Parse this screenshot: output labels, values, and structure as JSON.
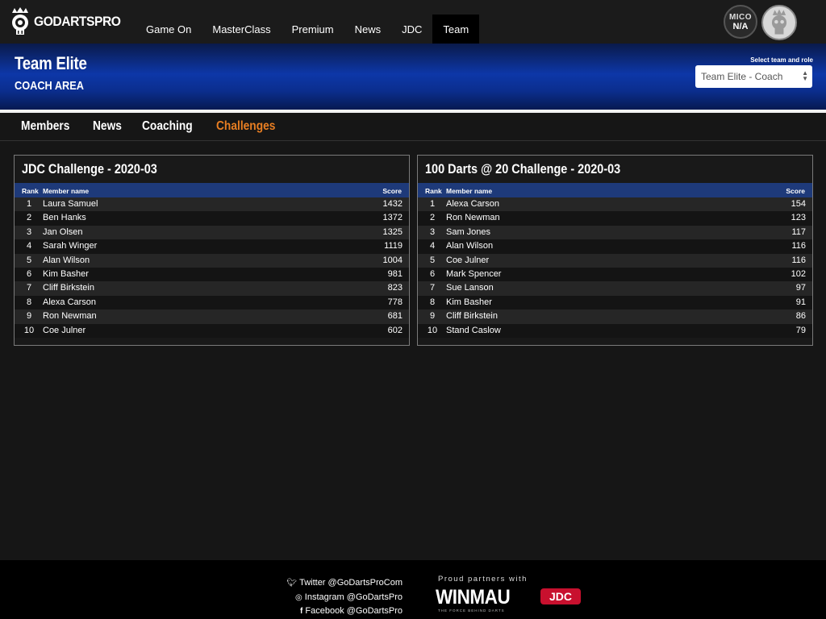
{
  "brand": {
    "name": "GODARTSPRO"
  },
  "nav": {
    "items": [
      {
        "label": "Game On",
        "active": false
      },
      {
        "label": "MasterClass",
        "active": false
      },
      {
        "label": "Premium",
        "active": false
      },
      {
        "label": "News",
        "active": false
      },
      {
        "label": "JDC",
        "active": false
      },
      {
        "label": "Team",
        "active": true
      }
    ]
  },
  "user": {
    "mico_label": "MICO",
    "mico_value": "N/A",
    "avatar_icon": "skull-king-avatar-icon"
  },
  "hero": {
    "title": "Team Elite",
    "subtitle": "COACH AREA",
    "select_label": "Select team and role",
    "select_value": "Team Elite - Coach"
  },
  "subnav": {
    "items": [
      {
        "label": "Members",
        "active": false
      },
      {
        "label": "News",
        "active": false
      },
      {
        "label": "Coaching",
        "active": false
      },
      {
        "label": "Challenges",
        "active": true
      }
    ],
    "active_color": "#e87e22"
  },
  "challenges": [
    {
      "title": "JDC Challenge - 2020-03",
      "headers": {
        "rank": "Rank",
        "name": "Member name",
        "score": "Score"
      },
      "rows": [
        {
          "rank": "1",
          "name": "Laura Samuel",
          "score": "1432"
        },
        {
          "rank": "2",
          "name": "Ben Hanks",
          "score": "1372"
        },
        {
          "rank": "3",
          "name": "Jan Olsen",
          "score": "1325"
        },
        {
          "rank": "4",
          "name": "Sarah Winger",
          "score": "1119"
        },
        {
          "rank": "5",
          "name": "Alan Wilson",
          "score": "1004"
        },
        {
          "rank": "6",
          "name": "Kim Basher",
          "score": "981"
        },
        {
          "rank": "7",
          "name": "Cliff Birkstein",
          "score": "823"
        },
        {
          "rank": "8",
          "name": "Alexa Carson",
          "score": "778"
        },
        {
          "rank": "9",
          "name": "Ron Newman",
          "score": "681"
        },
        {
          "rank": "10",
          "name": "Coe Julner",
          "score": "602"
        }
      ]
    },
    {
      "title": "100 Darts @ 20 Challenge - 2020-03",
      "headers": {
        "rank": "Rank",
        "name": "Member name",
        "score": "Score"
      },
      "rows": [
        {
          "rank": "1",
          "name": "Alexa Carson",
          "score": "154"
        },
        {
          "rank": "2",
          "name": "Ron Newman",
          "score": "123"
        },
        {
          "rank": "3",
          "name": "Sam Jones",
          "score": "117"
        },
        {
          "rank": "4",
          "name": "Alan Wilson",
          "score": "116"
        },
        {
          "rank": "5",
          "name": "Coe Julner",
          "score": "116"
        },
        {
          "rank": "6",
          "name": "Mark Spencer",
          "score": "102"
        },
        {
          "rank": "7",
          "name": "Sue Lanson",
          "score": "97"
        },
        {
          "rank": "8",
          "name": "Kim Basher",
          "score": "91"
        },
        {
          "rank": "9",
          "name": "Cliff Birkstein",
          "score": "86"
        },
        {
          "rank": "10",
          "name": "Stand Caslow",
          "score": "79"
        }
      ]
    }
  ],
  "footer": {
    "social": [
      {
        "icon": "twitter-icon",
        "label": "Twitter @GoDartsProCom"
      },
      {
        "icon": "instagram-icon",
        "label": "Instagram @GoDartsPro"
      },
      {
        "icon": "facebook-icon",
        "label": "Facebook @GoDartsPro"
      }
    ],
    "partners_label": "Proud partners with",
    "partner_winmau": "WINMAU",
    "partner_winmau_tagline": "THE FORCE BEHIND DARTS",
    "partner_jdc": "JDC"
  }
}
